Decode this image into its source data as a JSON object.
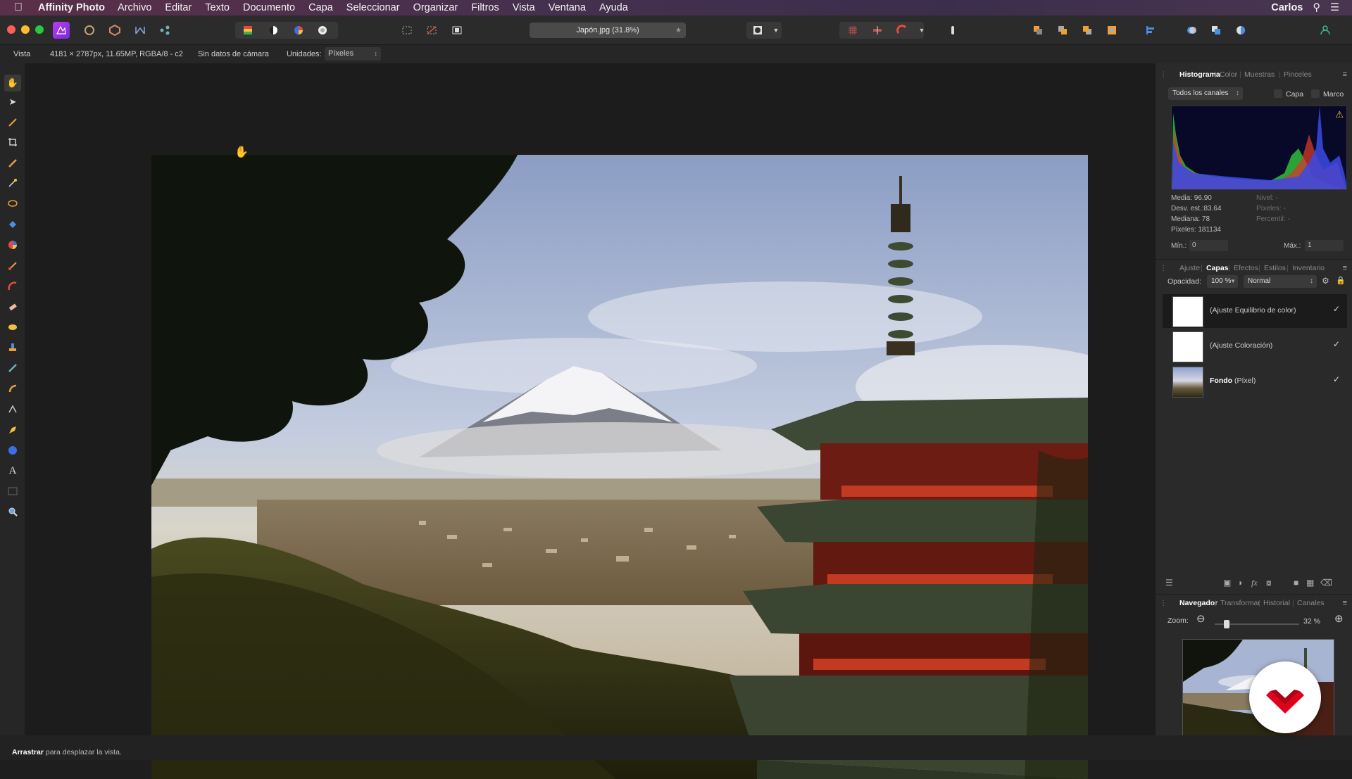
{
  "menubar": {
    "app_name": "Affinity Photo",
    "items": [
      "Archivo",
      "Editar",
      "Texto",
      "Documento",
      "Capa",
      "Seleccionar",
      "Organizar",
      "Filtros",
      "Vista",
      "Ventana",
      "Ayuda"
    ],
    "user": "Carlos"
  },
  "toolbar": {
    "document_tab": "Japón.jpg (31.8%)"
  },
  "contextbar": {
    "vista_label": "Vista",
    "image_info": "4181 × 2787px, 11.65MP, RGBA/8 - c2",
    "camera": "Sin datos de cámara",
    "units_label": "Unidades:",
    "units_value": "Píxeles"
  },
  "panels": {
    "top_tabs": [
      "Histograma",
      "Color",
      "Muestras",
      "Pinceles"
    ],
    "histogram": {
      "channels": "Todos los canales",
      "capa_label": "Capa",
      "marco_label": "Marco",
      "media": "Media: 96.90",
      "desv": "Desv. est.:83.64",
      "mediana": "Mediana: 78",
      "pixeles": "Píxeles: 181134",
      "nivel": "Nivel: -",
      "pixeles2": "Píxeles: -",
      "percentil": "Percentil: -",
      "min_label": "Mín.:",
      "min_value": "0",
      "max_label": "Máx.:",
      "max_value": "1"
    },
    "mid_tabs": [
      "Ajuste",
      "Capas",
      "Efectos",
      "Estilos",
      "Inventario"
    ],
    "layers": {
      "opacity_label": "Opacidad:",
      "opacity_value": "100 %",
      "blend_mode": "Normal",
      "rows": [
        {
          "name": "(Ajuste Equilibrio de color)",
          "check": "✓"
        },
        {
          "name": "(Ajuste Coloración)",
          "check": "✓"
        },
        {
          "name_bold": "Fondo",
          "name_rest": " (Píxel)",
          "check": "✓"
        }
      ]
    },
    "bottom_tabs": [
      "Navegador",
      "Transformar",
      "Historial",
      "Canales"
    ],
    "navigator": {
      "zoom_label": "Zoom:",
      "zoom_value": "32 %"
    }
  },
  "statusbar": {
    "bold": "Arrastrar",
    "rest": " para desplazar la vista."
  },
  "colors": {
    "menubar_accent": "#4a3050",
    "panel_bg": "#2a2a2a",
    "logo_red": "#e0001b"
  }
}
